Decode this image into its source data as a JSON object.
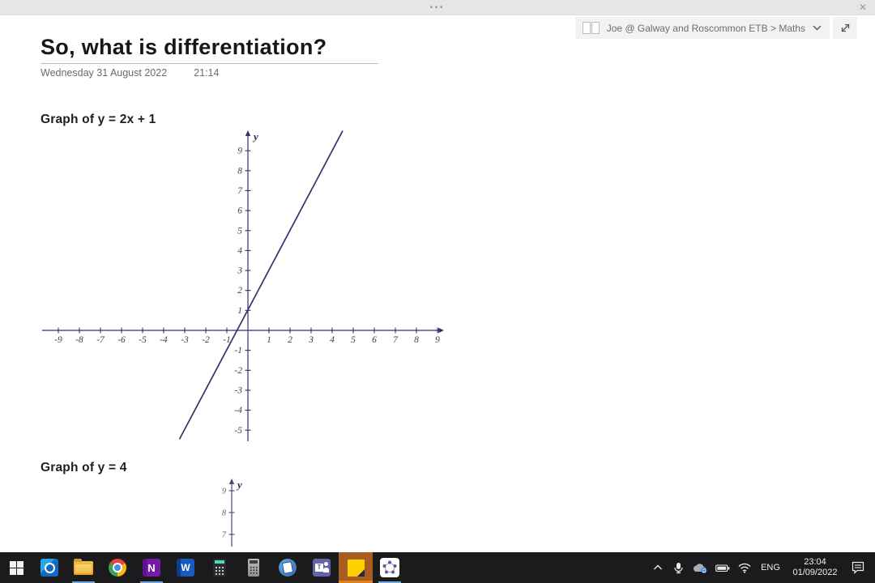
{
  "window": {
    "titlebar": {
      "drag_handle": "•••",
      "close_label": "✕"
    },
    "breadcrumb": {
      "text": "Joe @ Galway and Roscommon ETB > Maths"
    }
  },
  "page": {
    "title": "So, what is differentiation?",
    "date": "Wednesday 31 August 2022",
    "time": "21:14",
    "sections": [
      {
        "label": "Graph of y = 2x + 1"
      },
      {
        "label": "Graph of y = 4"
      }
    ]
  },
  "chart_data": [
    {
      "type": "line",
      "title": "Graph of y = 2x + 1",
      "equation": "y = 2x + 1",
      "slope": 2,
      "y_intercept": 1,
      "xlabel": "",
      "ylabel": "y",
      "xlim": [
        -9.8,
        9.4
      ],
      "ylim": [
        -5.7,
        10.2
      ],
      "xticks": [
        -9,
        -8,
        -7,
        -6,
        -5,
        -4,
        -3,
        -2,
        -1,
        1,
        2,
        3,
        4,
        5,
        6,
        7,
        8,
        9
      ],
      "yticks": [
        -5,
        -4,
        -3,
        -2,
        -1,
        1,
        2,
        3,
        4,
        5,
        6,
        7,
        8,
        9
      ],
      "grid": false,
      "legend": false,
      "line_segment": [
        [
          -3.25,
          -5.45
        ],
        [
          4.5,
          10
        ]
      ]
    },
    {
      "type": "line",
      "title": "Graph of y = 4",
      "equation": "y = 4",
      "ylabel": "y",
      "yticks": [
        9,
        8,
        7
      ],
      "clipped_by_window_edge": true
    }
  ],
  "taskbar": {
    "language": "ENG",
    "time": "23:04",
    "date": "01/09/2022",
    "icon_letters": {
      "onenote": "N",
      "word": "W",
      "teams": "T"
    },
    "apps": [
      {
        "name": "start",
        "running": false
      },
      {
        "name": "outlook",
        "running": false
      },
      {
        "name": "file-explorer",
        "running": true
      },
      {
        "name": "chrome",
        "running": false
      },
      {
        "name": "onenote",
        "running": true
      },
      {
        "name": "word",
        "running": false
      },
      {
        "name": "calculator",
        "running": false
      },
      {
        "name": "scientific-calculator",
        "running": false
      },
      {
        "name": "smart-notebook",
        "running": false
      },
      {
        "name": "teams",
        "running": false
      },
      {
        "name": "sticky-notes",
        "running": true,
        "active": true
      },
      {
        "name": "geogebra",
        "running": true
      }
    ],
    "tray_icons": [
      "chevron-up",
      "microphone",
      "onedrive-sync",
      "battery",
      "wifi",
      "action-center"
    ]
  }
}
